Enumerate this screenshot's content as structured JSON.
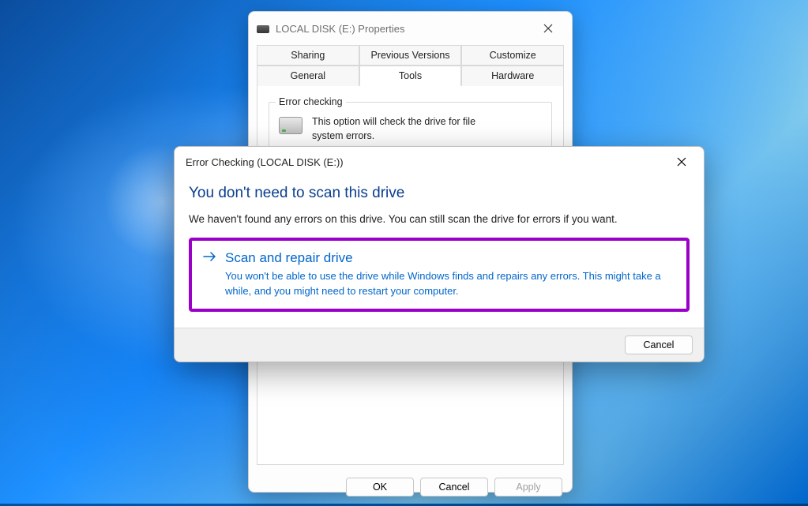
{
  "properties": {
    "title": "LOCAL DISK (E:) Properties",
    "tabs_row1": [
      "Sharing",
      "Previous Versions",
      "Customize"
    ],
    "tabs_row2": [
      "General",
      "Tools",
      "Hardware"
    ],
    "selected_tab": "Tools",
    "group": {
      "label": "Error checking",
      "text": "This option will check the drive for file system errors."
    },
    "buttons": {
      "ok": "OK",
      "cancel": "Cancel",
      "apply": "Apply"
    }
  },
  "dialog": {
    "title": "Error Checking (LOCAL DISK (E:))",
    "heading": "You don't need to scan this drive",
    "description": "We haven't found any errors on this drive. You can still scan the drive for errors if you want.",
    "option": {
      "title": "Scan and repair drive",
      "subtitle": "You won't be able to use the drive while Windows finds and repairs any errors. This might take a while, and you might need to restart your computer."
    },
    "cancel": "Cancel"
  }
}
